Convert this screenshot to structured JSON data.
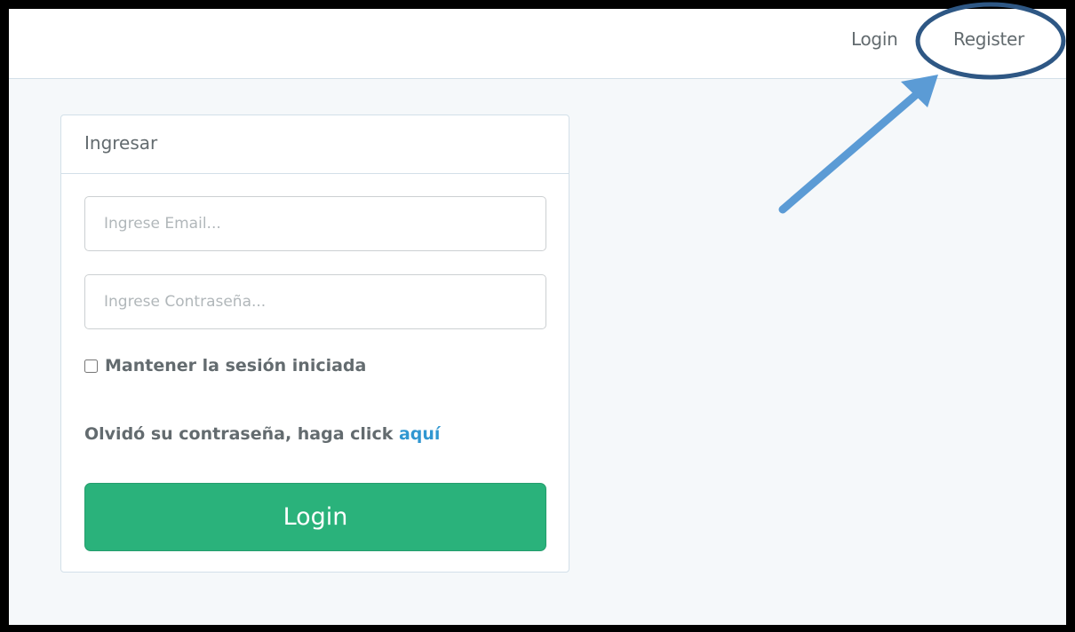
{
  "navbar": {
    "login_label": "Login",
    "register_label": "Register"
  },
  "panel": {
    "heading": "Ingresar",
    "email": {
      "value": "",
      "placeholder": "Ingrese Email..."
    },
    "password": {
      "value": "",
      "placeholder": "Ingrese Contraseña..."
    },
    "remember": {
      "label": "Mantener la sesión iniciada",
      "checked": false
    },
    "forgot": {
      "text": "Olvidó su contraseña, haga click ",
      "link_label": "aquí"
    },
    "submit_label": "Login"
  },
  "colors": {
    "primary_button": "#2ab27b",
    "link": "#3097d1",
    "annotation": "#5b9bd5",
    "annotation_outline": "#2e5784"
  },
  "annotation": {
    "circle_target": "register-link",
    "arrow_icon": "arrow-up-right-icon"
  }
}
